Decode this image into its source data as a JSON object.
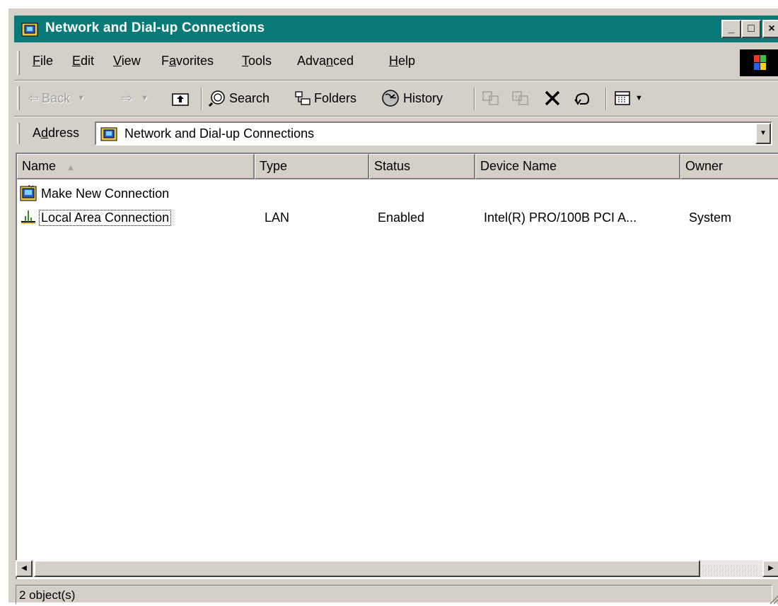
{
  "window": {
    "title": "Network and Dial-up Connections",
    "buttons": {
      "minimize": "_",
      "maximize": "□",
      "close": "×"
    }
  },
  "menu": [
    {
      "label": "File",
      "accel": "F",
      "rest": "ile"
    },
    {
      "label": "Edit",
      "accel": "E",
      "rest": "dit"
    },
    {
      "label": "View",
      "accel": "V",
      "rest": "iew"
    },
    {
      "label": "Favorites",
      "pre": "F",
      "accel": "a",
      "rest": "vorites"
    },
    {
      "label": "Tools",
      "accel": "T",
      "rest": "ools"
    },
    {
      "label": "Advanced",
      "pre": "Adva",
      "accel": "n",
      "rest": "ced"
    },
    {
      "label": "Help",
      "accel": "H",
      "rest": "elp"
    }
  ],
  "toolbar": {
    "back": "Back",
    "search": "Search",
    "folders": "Folders",
    "history": "History"
  },
  "address": {
    "label_pre": "A",
    "label_accel": "d",
    "label_rest": "dress",
    "value": "Network and Dial-up Connections"
  },
  "columns": [
    "Name",
    "Type",
    "Status",
    "Device Name",
    "Owner"
  ],
  "rows": [
    {
      "name": "Make New Connection",
      "type": "",
      "status": "",
      "device": "",
      "owner": "",
      "icon": "new-connection-icon"
    },
    {
      "name": "Local Area Connection",
      "type": "LAN",
      "status": "Enabled",
      "device": "Intel(R) PRO/100B PCI A...",
      "owner": "System",
      "icon": "lan-connection-icon"
    }
  ],
  "status": {
    "text": "2 object(s)"
  },
  "colors": {
    "titlebar": "#0a7a78",
    "face": "#d4d0c8"
  }
}
